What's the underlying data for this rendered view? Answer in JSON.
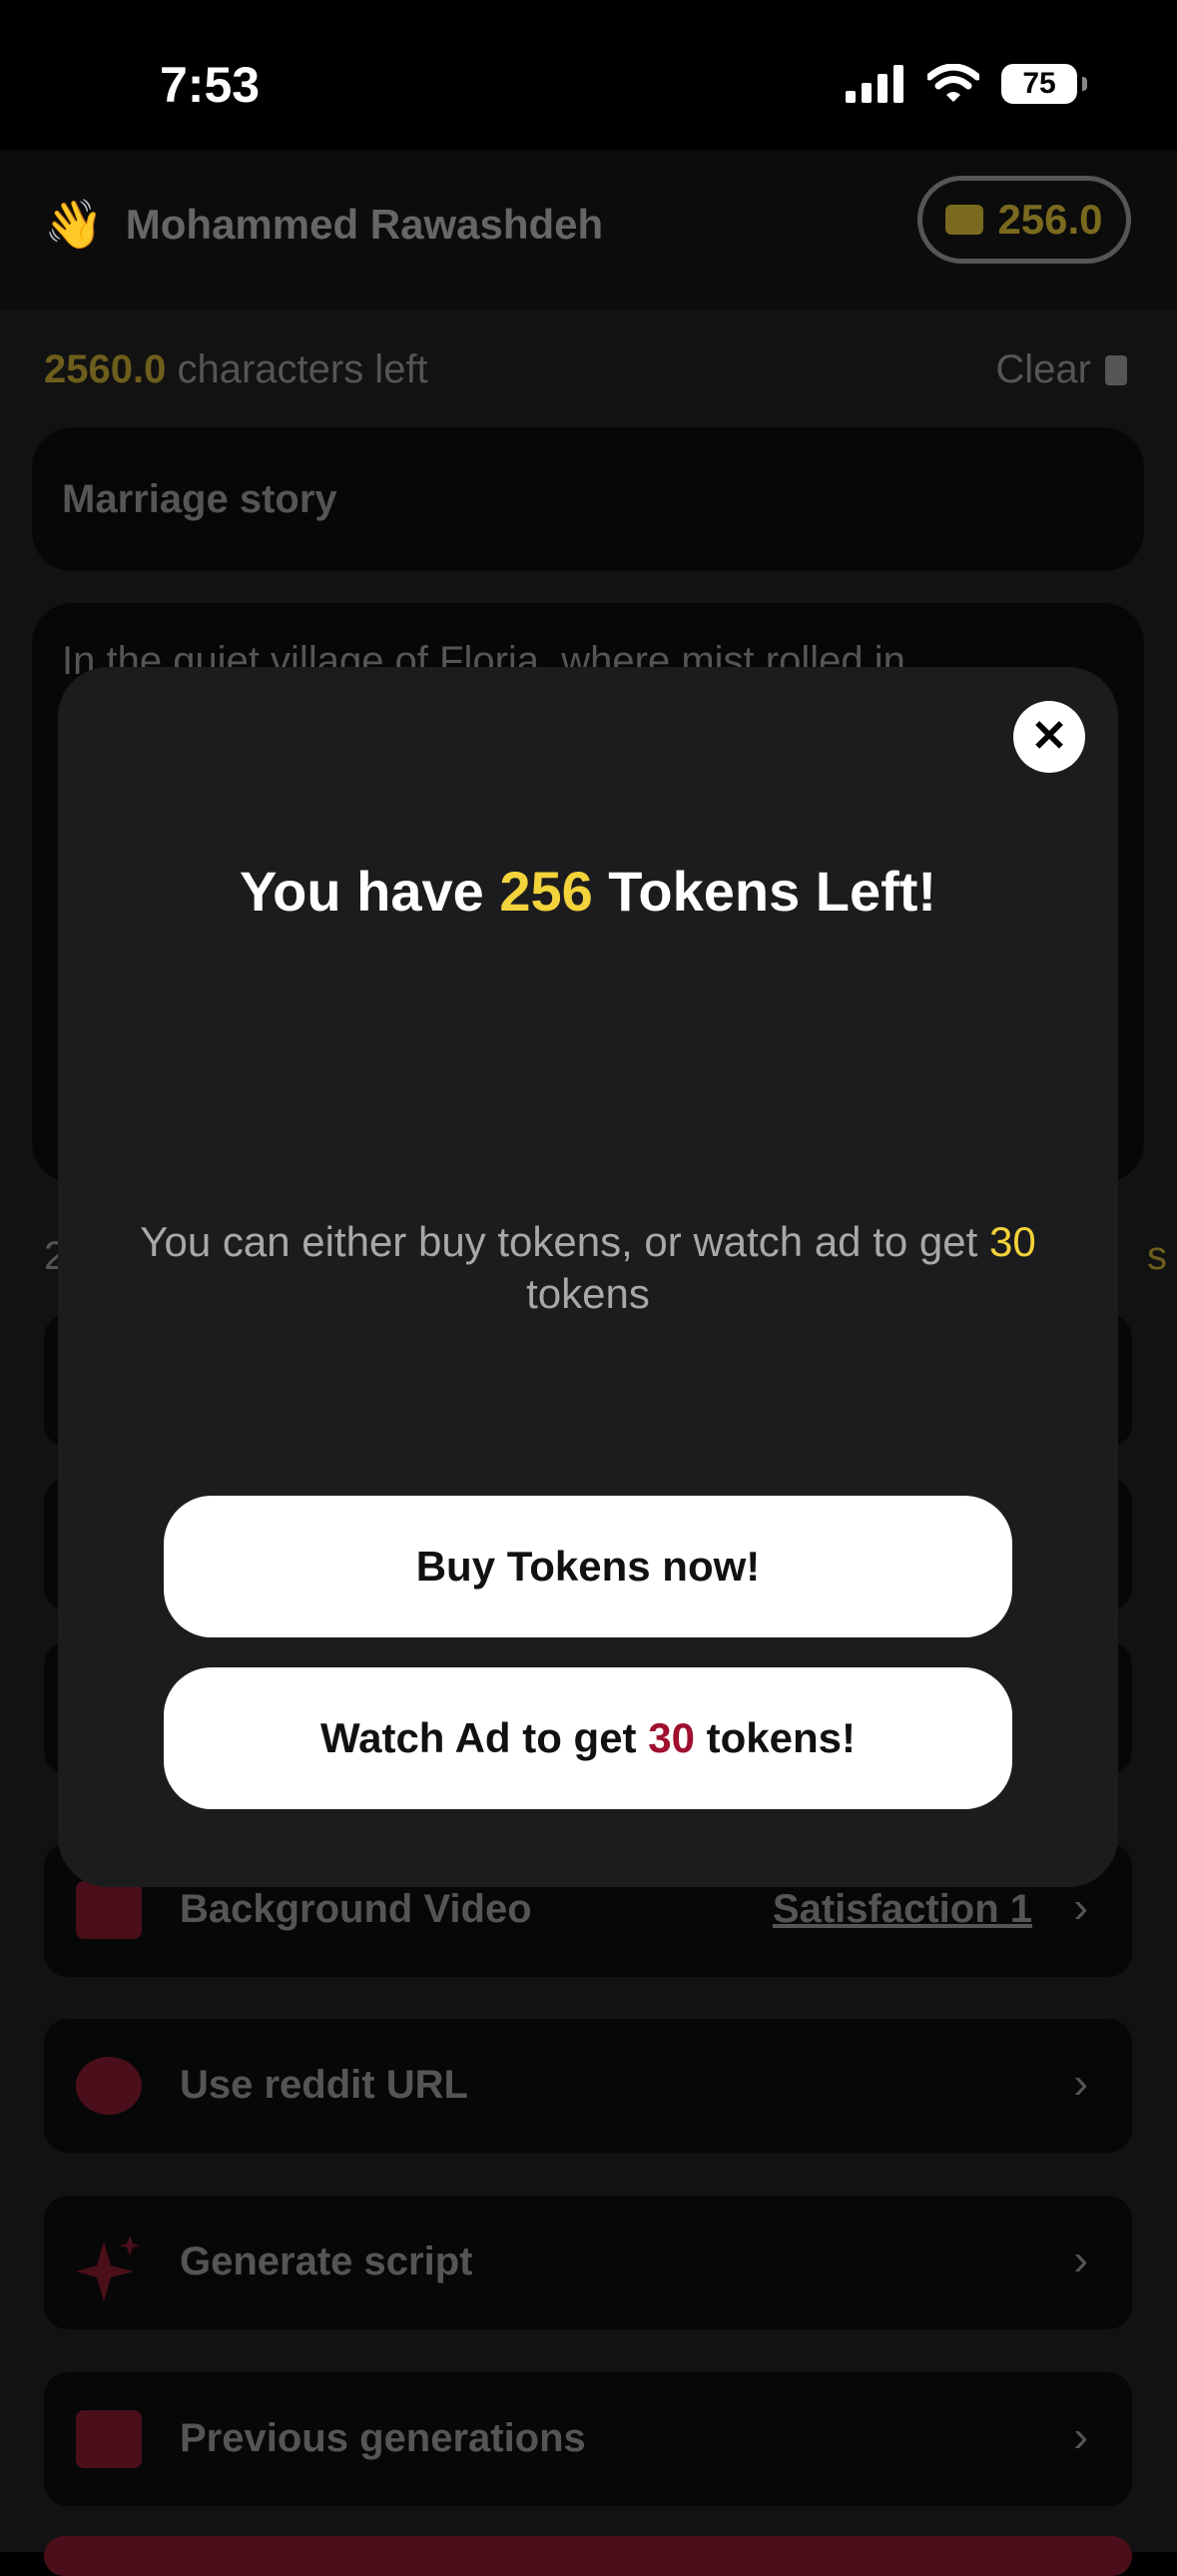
{
  "status_bar": {
    "time": "7:53",
    "battery": "75"
  },
  "header": {
    "wave_emoji": "👋",
    "user_name": "Mohammed Rawashdeh",
    "wallet_balance": "256.0"
  },
  "editor": {
    "chars_left_number": "2560.0",
    "chars_left_text": " characters left",
    "clear_label": "Clear",
    "title_value": "Marriage story",
    "story_preview": "In the quiet village of Floria, where mist rolled in"
  },
  "background_partial": {
    "left_char": "2",
    "right_char": "s"
  },
  "settings_rows": [
    {
      "label": "Background Video",
      "value": "Satisfaction 1"
    },
    {
      "label": "Use reddit URL"
    },
    {
      "label": "Generate script"
    },
    {
      "label": "Previous generations"
    }
  ],
  "modal": {
    "title_prefix": "You have ",
    "title_count": "256",
    "title_suffix": " Tokens Left!",
    "desc_prefix": "You can either buy tokens, or watch ad to get ",
    "desc_amount": "30",
    "desc_suffix": " tokens",
    "buy_label": "Buy Tokens now!",
    "ad_prefix": "Watch Ad to get ",
    "ad_amount": "30",
    "ad_suffix": " tokens!"
  },
  "colors": {
    "accent_yellow": "#f2d33b",
    "accent_red": "#a0102e",
    "modal_bg": "#1c1c1e"
  },
  "icons": [
    "signal-icon",
    "wifi-icon",
    "battery-icon",
    "wallet-icon",
    "trash-icon",
    "close-icon",
    "film-icon",
    "reddit-icon",
    "sparkle-icon",
    "video-camera-icon",
    "chevron-right-icon"
  ]
}
